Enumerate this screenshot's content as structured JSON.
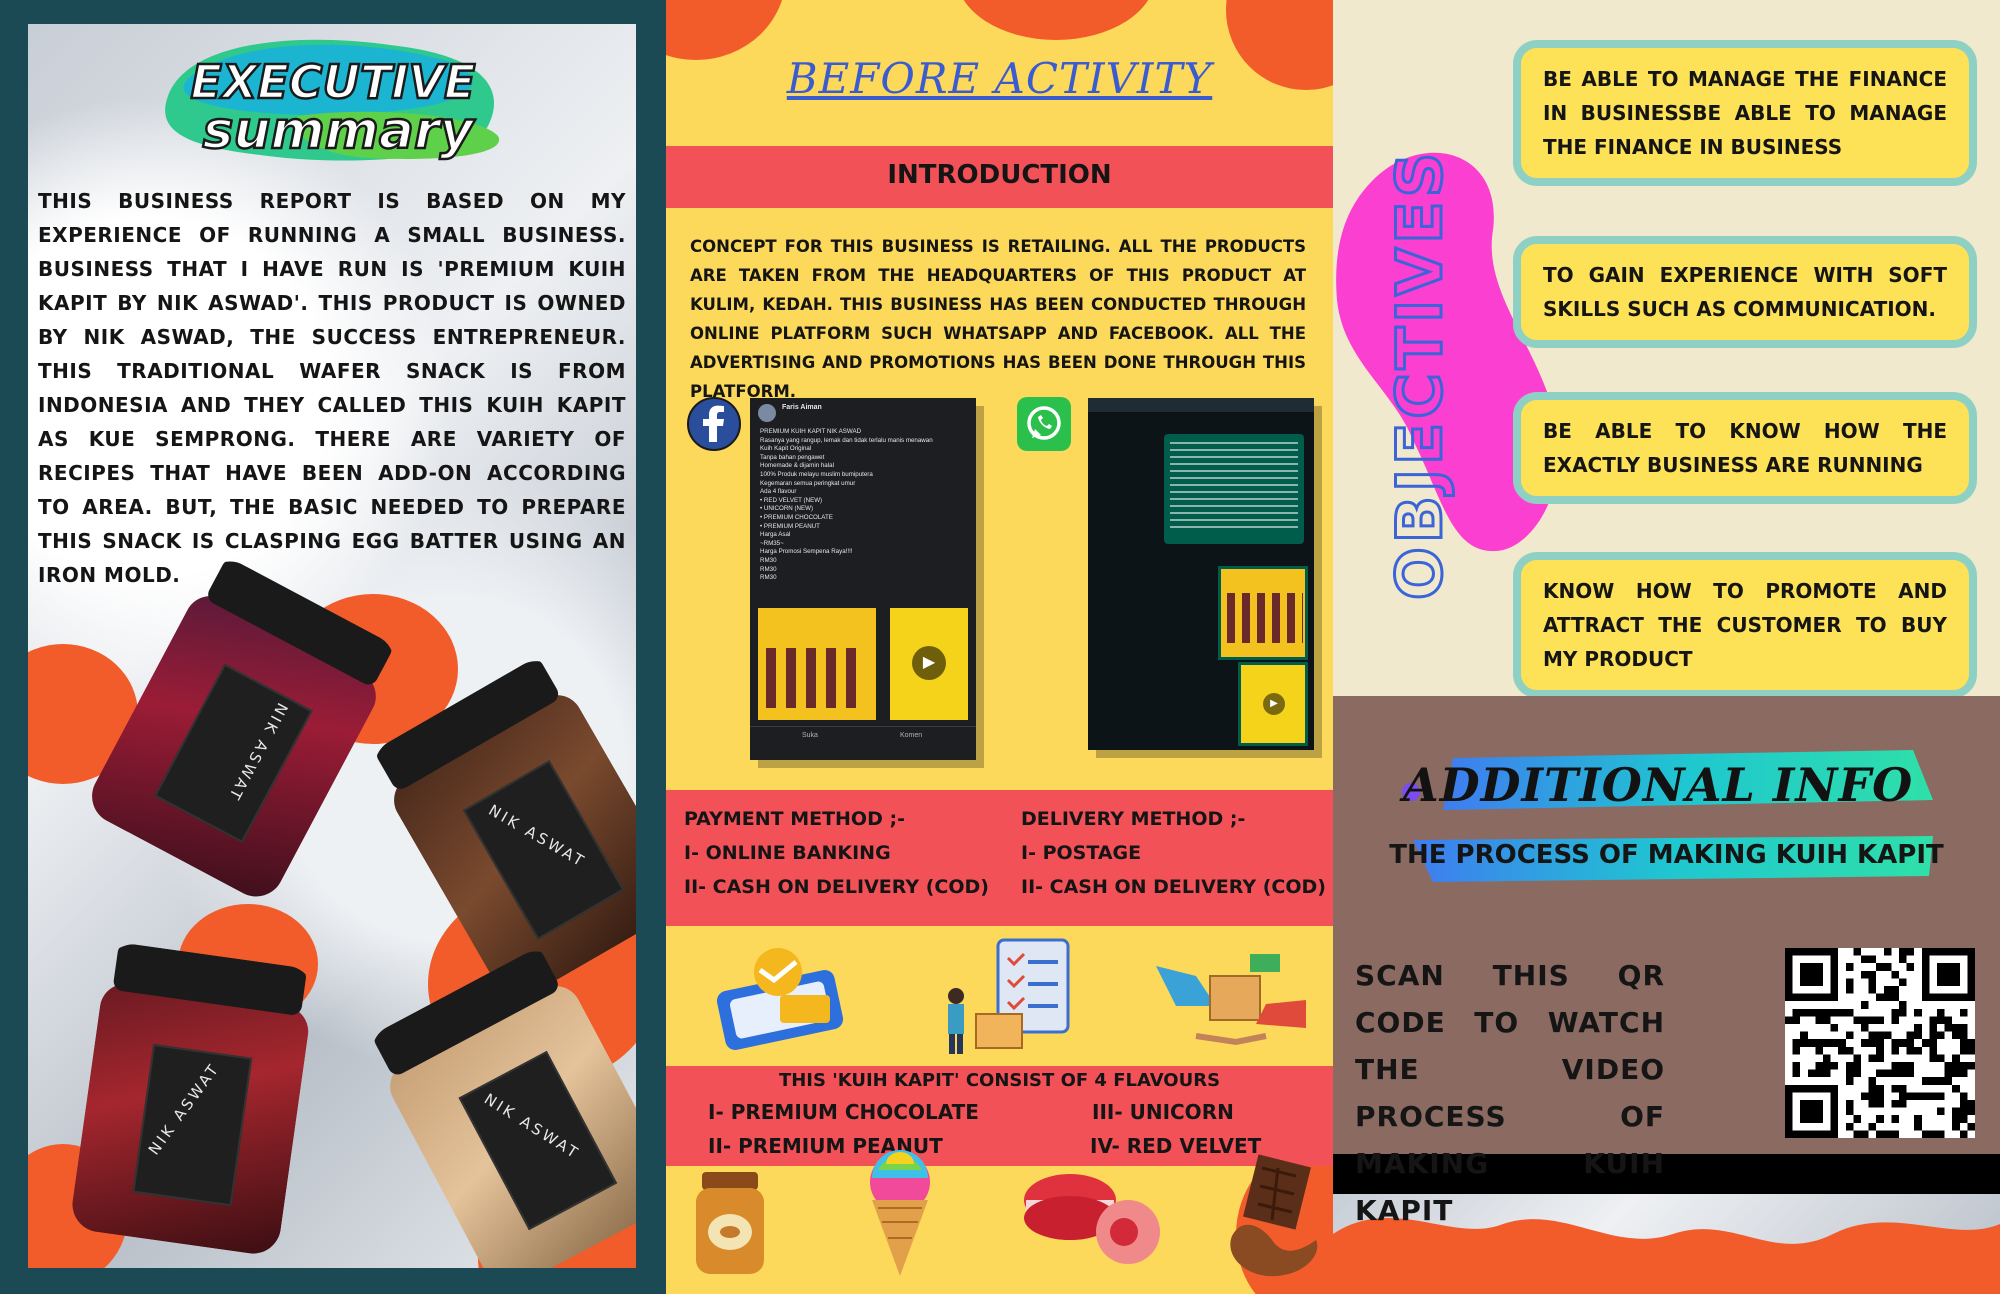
{
  "executive_summary": {
    "title_line1": "EXECUTIVE",
    "title_line2": "summary",
    "body": "THIS BUSINESS REPORT IS BASED ON MY EXPERIENCE OF RUNNING A SMALL BUSINESS. BUSINESS THAT I HAVE RUN IS 'PREMIUM KUIH KAPIT BY NIK ASWAD'. THIS PRODUCT IS OWNED BY NIK ASWAD, THE SUCCESS ENTREPRENEUR. THIS TRADITIONAL WAFER SNACK IS FROM INDONESIA AND THEY CALLED THIS KUIH KAPIT AS KUE SEMPRONG. THERE ARE VARIETY OF RECIPES THAT HAVE BEEN ADD-ON ACCORDING TO AREA. BUT, THE BASIC NEEDED TO PREPARE THIS SNACK IS CLASPING EGG BATTER USING AN IRON MOLD.",
    "jar_brand": "NIK ASWAT"
  },
  "before_activity": {
    "title": "BEFORE ACTIVITY",
    "intro_title": "INTRODUCTION",
    "intro_text": "CONCEPT FOR THIS BUSINESS IS RETAILING. ALL THE PRODUCTS ARE TAKEN FROM THE HEADQUARTERS OF THIS PRODUCT AT KULIM, KEDAH. THIS BUSINESS HAS BEEN CONDUCTED THROUGH ONLINE PLATFORM SUCH WHATSAPP AND FACEBOOK. ALL THE ADVERTISING AND PROMOTIONS HAS BEEN DONE THROUGH THIS PLATFORM.",
    "facebook_post": {
      "author": "Faris Aiman",
      "lines": [
        "PREMIUM KUIH KAPIT NIK ASWAD",
        "Rasanya yang rangup, lemak dan tidak terlalu manis menawan",
        "Kuih Kapit Original",
        "Tanpa bahan pengawet",
        "Homemade & dijamin halal",
        "100% Produk melayu muslim bumiputera",
        "Kegemaran semua peringkat umur",
        "Ada 4 flavour",
        "• RED VELVET (NEW)",
        "• UNICORN (NEW)",
        "• PREMIUM CHOCOLATE",
        "• PREMIUM PEANUT",
        "Harga Asal",
        "~RM35~",
        "Harga Promosi Sempena Raya!!!!",
        "RM30",
        "RM30",
        "RM30"
      ],
      "like": "Suka",
      "comment": "Komen"
    },
    "payment_title": "PAYMENT METHOD ;-",
    "payment_items": [
      "I- ONLINE BANKING",
      "II- CASH ON DELIVERY (COD)"
    ],
    "delivery_title": "DELIVERY METHOD ;-",
    "delivery_items": [
      "I- POSTAGE",
      "II- CASH ON DELIVERY (COD)"
    ],
    "flavours_title": "THIS 'KUIH KAPIT' CONSIST OF 4 FLAVOURS",
    "flavours": [
      "I- PREMIUM CHOCOLATE",
      "II- PREMIUM PEANUT",
      "III- UNICORN",
      "IV- RED VELVET"
    ]
  },
  "objectives": {
    "title": "OBJECTIVES",
    "items": [
      "BE ABLE TO MANAGE THE FINANCE IN BUSINESSBE ABLE TO MANAGE THE FINANCE IN BUSINESS",
      "TO GAIN EXPERIENCE WITH SOFT SKILLS SUCH AS COMMUNICATION.",
      "BE ABLE TO KNOW HOW THE EXACTLY BUSINESS ARE RUNNING",
      "KNOW HOW TO PROMOTE AND ATTRACT THE CUSTOMER TO BUY MY PRODUCT"
    ]
  },
  "additional_info": {
    "title": "ADDITIONAL INFO",
    "subtitle": "THE PROCESS OF MAKING KUIH KAPIT",
    "scan_text": "SCAN THIS QR CODE TO WATCH THE VIDEO PROCESS OF MAKING KUIH KAPIT"
  },
  "colors": {
    "orange": "#f25b2a",
    "yellow": "#fcd95a",
    "red": "#f25157",
    "teal": "#8fd0c5",
    "brown": "#8b6a62"
  }
}
